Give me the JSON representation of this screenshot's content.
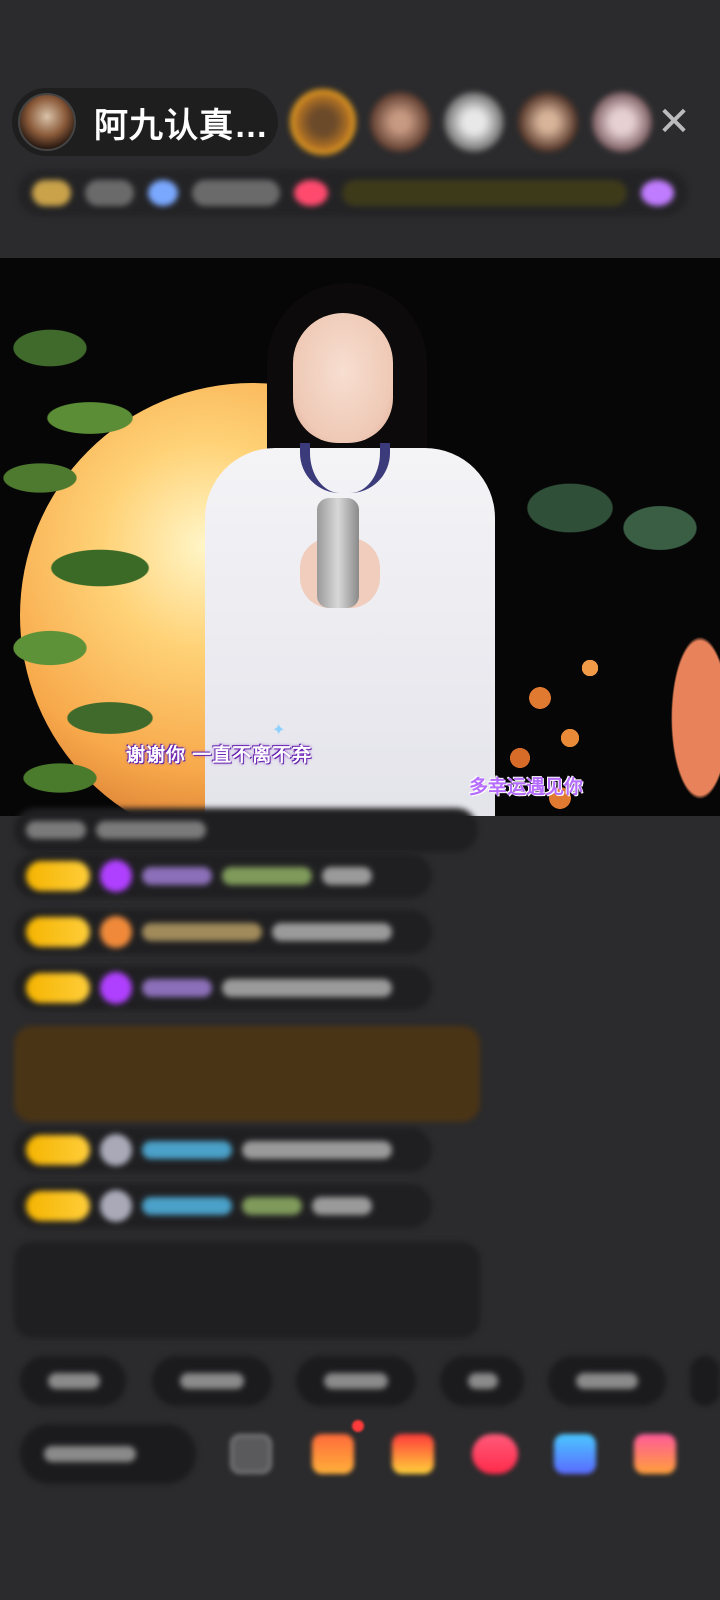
{
  "header": {
    "host_name": "阿九认真…",
    "close_label": "✕"
  },
  "video": {
    "lyric_left": "谢谢你  一直不离不弃",
    "lyric_right": "多幸运遇见你"
  },
  "colors": {
    "background": "#2b2b2d",
    "badge_gold": "#f5b400",
    "gem_purple": "#b040ff",
    "highlight_brown": "#4a3416",
    "system_green": "#8fd07a"
  }
}
